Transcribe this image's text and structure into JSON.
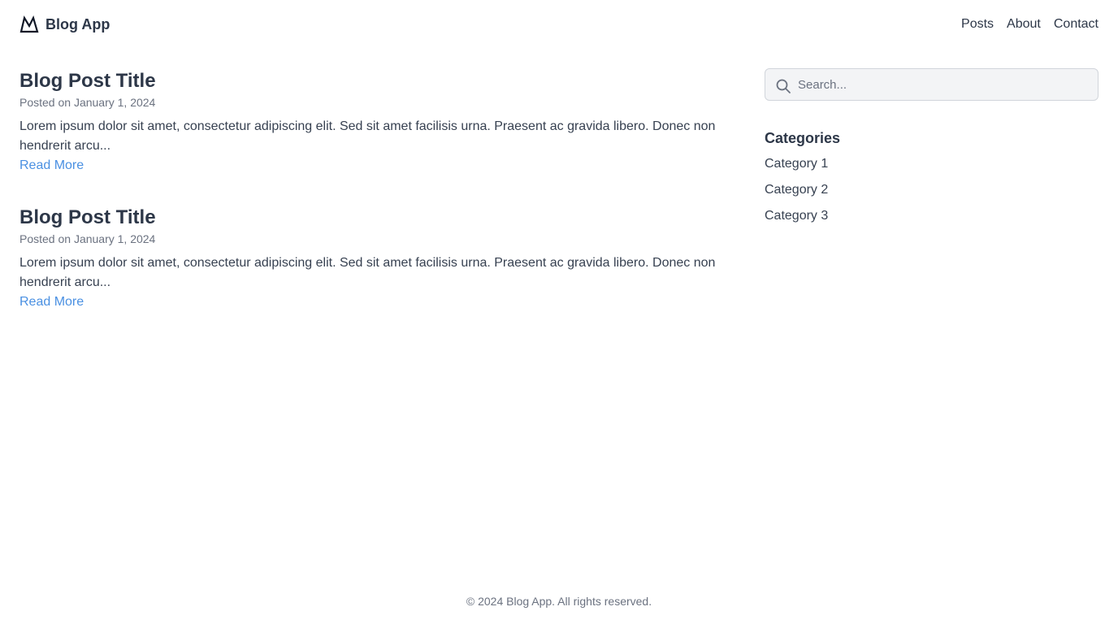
{
  "header": {
    "brand": "Blog App",
    "brand_icon": "mountain-logo-icon",
    "nav": [
      "Posts",
      "About",
      "Contact"
    ]
  },
  "posts": [
    {
      "title": "Blog Post Title",
      "meta": "Posted on January 1, 2024",
      "excerpt": "Lorem ipsum dolor sit amet, consectetur adipiscing elit. Sed sit amet facilisis urna. Praesent ac gravida libero. Donec non hendrerit arcu...",
      "read_more": "Read More"
    },
    {
      "title": "Blog Post Title",
      "meta": "Posted on January 1, 2024",
      "excerpt": "Lorem ipsum dolor sit amet, consectetur adipiscing elit. Sed sit amet facilisis urna. Praesent ac gravida libero. Donec non hendrerit arcu...",
      "read_more": "Read More"
    }
  ],
  "sidebar": {
    "search": {
      "placeholder": "Search...",
      "value": "",
      "icon": "search-icon"
    },
    "categories_title": "Categories",
    "categories": [
      "Category 1",
      "Category 2",
      "Category 3"
    ]
  },
  "footer": {
    "text": "© 2024 Blog App. All rights reserved."
  },
  "colors": {
    "link": "#4a90e2",
    "heading": "#2d3748",
    "muted": "#6b7280",
    "search_bg": "#f3f4f6"
  }
}
